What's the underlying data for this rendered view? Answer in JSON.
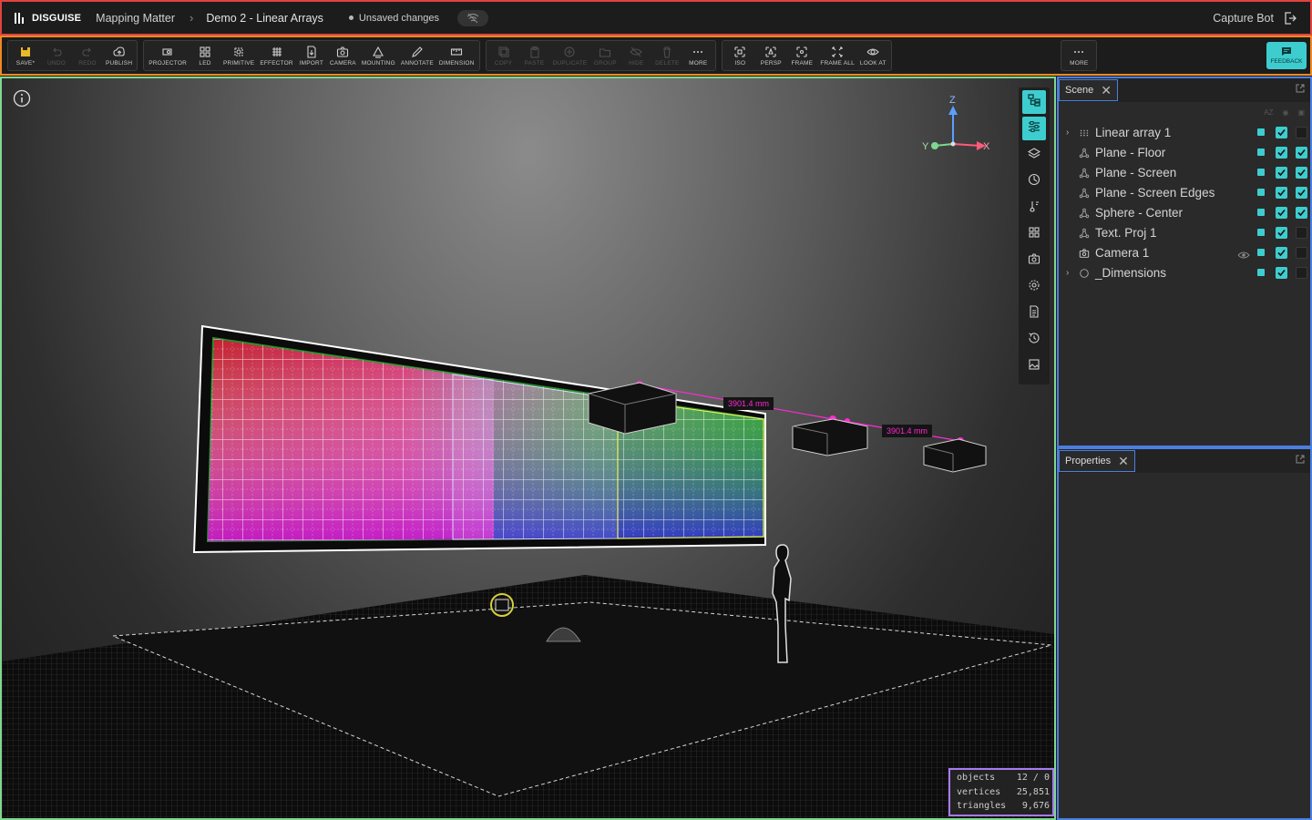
{
  "app": {
    "brand": "DISGUISE",
    "project": "Mapping Matter",
    "document": "Demo 2 - Linear Arrays",
    "unsaved": "Unsaved changes",
    "user": "Capture Bot"
  },
  "toolbar": {
    "file": [
      {
        "label": "SAVE*",
        "icon": "save-icon",
        "enabled": true
      },
      {
        "label": "UNDO",
        "icon": "undo-icon",
        "enabled": false
      },
      {
        "label": "REDO",
        "icon": "redo-icon",
        "enabled": false
      },
      {
        "label": "PUBLISH",
        "icon": "cloud-upload-icon",
        "enabled": true
      }
    ],
    "create": [
      {
        "label": "PROJECTOR",
        "icon": "projector-icon",
        "enabled": true
      },
      {
        "label": "LED",
        "icon": "led-icon",
        "enabled": true
      },
      {
        "label": "PRIMITIVE",
        "icon": "primitive-icon",
        "enabled": true
      },
      {
        "label": "EFFECTOR",
        "icon": "effector-icon",
        "enabled": true
      },
      {
        "label": "IMPORT",
        "icon": "import-icon",
        "enabled": true
      },
      {
        "label": "CAMERA",
        "icon": "camera-icon",
        "enabled": true
      },
      {
        "label": "MOUNTING",
        "icon": "mounting-icon",
        "enabled": true
      },
      {
        "label": "ANNOTATE",
        "icon": "pencil-icon",
        "enabled": true
      },
      {
        "label": "DIMENSION",
        "icon": "dimension-icon",
        "enabled": true
      }
    ],
    "edit": [
      {
        "label": "COPY",
        "icon": "copy-icon",
        "enabled": false
      },
      {
        "label": "PASTE",
        "icon": "paste-icon",
        "enabled": false
      },
      {
        "label": "DUPLICATE",
        "icon": "duplicate-icon",
        "enabled": false
      },
      {
        "label": "GROUP",
        "icon": "group-icon",
        "enabled": false
      },
      {
        "label": "HIDE",
        "icon": "hide-icon",
        "enabled": false
      },
      {
        "label": "DELETE",
        "icon": "trash-icon",
        "enabled": false
      },
      {
        "label": "MORE",
        "icon": "more-icon",
        "enabled": true
      }
    ],
    "view": [
      {
        "label": "ISO",
        "icon": "iso-icon",
        "enabled": true
      },
      {
        "label": "PERSP",
        "icon": "persp-icon",
        "enabled": true
      },
      {
        "label": "FRAME",
        "icon": "frame-icon",
        "enabled": true
      },
      {
        "label": "FRAME ALL",
        "icon": "frame-all-icon",
        "enabled": true
      },
      {
        "label": "LOOK AT",
        "icon": "eye-icon",
        "enabled": true
      }
    ],
    "more": {
      "label": "MORE"
    },
    "feedback": {
      "label": "FEEDBACK"
    }
  },
  "viewport": {
    "axes": {
      "z": "Z",
      "y": "Y",
      "x": "X"
    },
    "dimensions": [
      "3901.4 mm",
      "3901.4 mm"
    ],
    "stats": [
      {
        "name": "objects",
        "value": "12 / 0"
      },
      {
        "name": "vertices",
        "value": "25,851"
      },
      {
        "name": "triangles",
        "value": "9,676"
      }
    ],
    "tools": [
      "scene-tree-icon",
      "properties-icon",
      "layers-icon",
      "explode-icon",
      "thermometer-icon",
      "grid-icon",
      "camera-icon",
      "settings-icon",
      "document-icon",
      "history-icon",
      "image-icon"
    ],
    "active_tools": [
      0,
      1
    ]
  },
  "scene_panel": {
    "tab": "Scene",
    "items": [
      {
        "label": "Linear array 1",
        "icon": "array-icon",
        "expandable": true,
        "eye": false,
        "check1": true,
        "check2": false
      },
      {
        "label": "Plane - Floor",
        "icon": "mesh-icon",
        "expandable": false,
        "eye": false,
        "check1": true,
        "check2": true
      },
      {
        "label": "Plane - Screen",
        "icon": "mesh-icon",
        "expandable": false,
        "eye": false,
        "check1": true,
        "check2": true
      },
      {
        "label": "Plane - Screen Edges",
        "icon": "mesh-icon",
        "expandable": false,
        "eye": false,
        "check1": true,
        "check2": true
      },
      {
        "label": "Sphere - Center",
        "icon": "mesh-icon",
        "expandable": false,
        "eye": false,
        "check1": true,
        "check2": true
      },
      {
        "label": "Text. Proj 1",
        "icon": "mesh-icon",
        "expandable": false,
        "eye": false,
        "check1": true,
        "check2": false
      },
      {
        "label": "Camera 1",
        "icon": "camera-icon",
        "expandable": false,
        "eye": true,
        "check1": true,
        "check2": false
      },
      {
        "label": "_Dimensions",
        "icon": "circle-icon",
        "expandable": true,
        "eye": false,
        "check1": true,
        "check2": false
      }
    ]
  },
  "properties_panel": {
    "tab": "Properties"
  },
  "colors": {
    "accent": "#3ecdcf",
    "dimension": "#ff2ad5"
  }
}
